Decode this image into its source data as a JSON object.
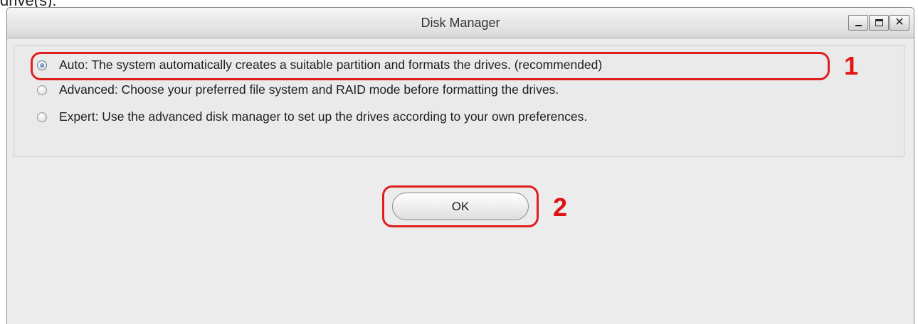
{
  "top_text": "drive(s).",
  "window": {
    "title": "Disk Manager",
    "controls": {
      "minimize_icon": "minimize-icon",
      "maximize_icon": "maximize-icon",
      "close_icon": "close-icon"
    }
  },
  "options": [
    {
      "label": "Auto: The system automatically creates a suitable partition and formats the drives. (recommended)",
      "selected": true
    },
    {
      "label": "Advanced: Choose your preferred file system and RAID mode before formatting the drives.",
      "selected": false
    },
    {
      "label": "Expert: Use the advanced disk manager to set up the drives according to your own preferences.",
      "selected": false
    }
  ],
  "ok_label": "OK",
  "annotations": {
    "step1": "1",
    "step2": "2",
    "highlight_color": "#e01e1e"
  }
}
